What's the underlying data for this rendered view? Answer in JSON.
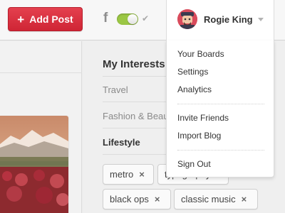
{
  "header": {
    "add_post_label": "Add Post",
    "add_post_icon": "plus-icon",
    "social_icon": "facebook-icon",
    "share_toggle_on": true,
    "check_icon": "check-icon",
    "brand_color": "#d9303f",
    "toggle_color": "#9bc744"
  },
  "user_menu": {
    "name": "Rogie King",
    "avatar_icon": "avatar-icon",
    "caret_icon": "caret-down-icon",
    "groups": [
      {
        "items": [
          "Your Boards",
          "Settings",
          "Analytics"
        ]
      },
      {
        "items": [
          "Invite Friends",
          "Import Blog"
        ]
      },
      {
        "items": [
          "Sign Out"
        ]
      }
    ]
  },
  "interests": {
    "title": "My Interests",
    "categories": [
      {
        "label": "Travel",
        "active": false
      },
      {
        "label": "Fashion & Beauty",
        "active": false
      },
      {
        "label": "Lifestyle",
        "active": true
      }
    ],
    "tags": [
      {
        "label": "metro",
        "remove": "×"
      },
      {
        "label": "typography",
        "remove": "×"
      },
      {
        "label": "black ops",
        "remove": "×"
      },
      {
        "label": "classic music",
        "remove": "×"
      }
    ]
  }
}
